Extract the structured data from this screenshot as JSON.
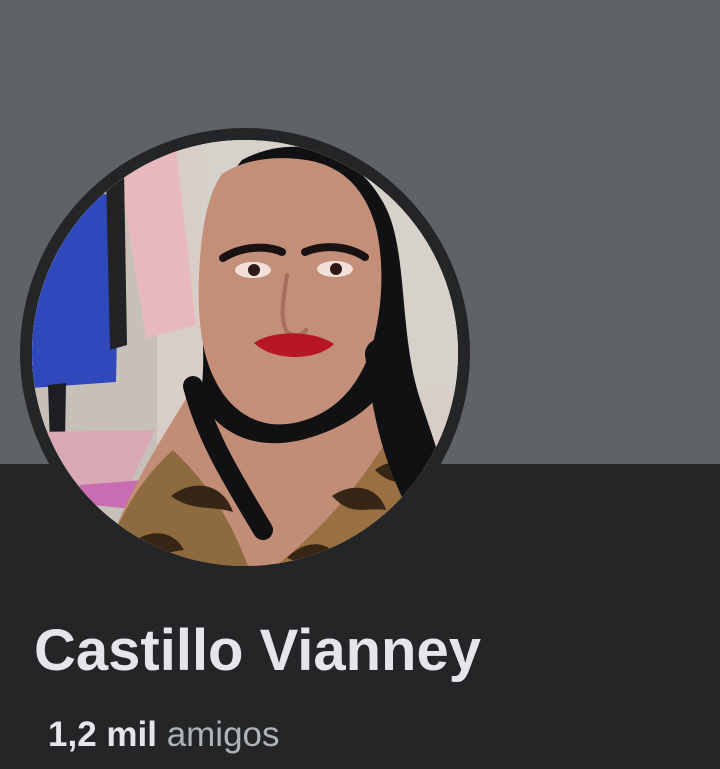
{
  "profile": {
    "name": "Castillo Vianney",
    "friends": {
      "count": "1,2 mil",
      "label": "amigos"
    },
    "avatar": {
      "semantic": "profile-photo"
    }
  },
  "colors": {
    "cover": "#5f6267",
    "background": "#242527",
    "name_text": "#e4e6eb",
    "secondary_text": "#b0b3b8"
  }
}
